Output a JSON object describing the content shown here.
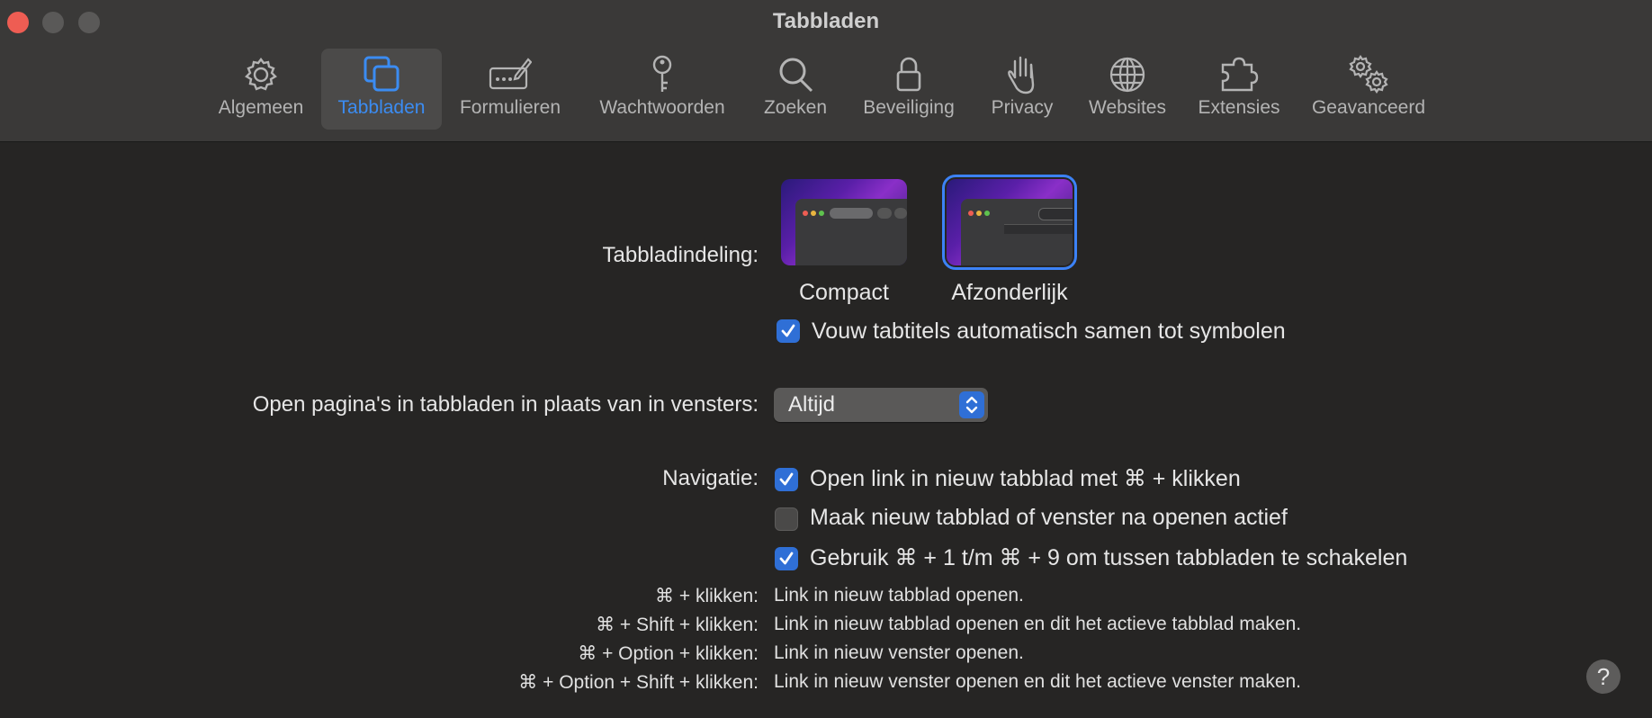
{
  "window": {
    "title": "Tabbladen"
  },
  "toolbar": {
    "tabs": [
      {
        "label": "Algemeen",
        "icon": "gear-icon"
      },
      {
        "label": "Tabbladen",
        "icon": "tabs-icon",
        "active": true
      },
      {
        "label": "Formulieren",
        "icon": "form-pen-icon"
      },
      {
        "label": "Wachtwoorden",
        "icon": "key-icon"
      },
      {
        "label": "Zoeken",
        "icon": "search-icon"
      },
      {
        "label": "Beveiliging",
        "icon": "lock-icon"
      },
      {
        "label": "Privacy",
        "icon": "hand-icon"
      },
      {
        "label": "Websites",
        "icon": "globe-icon"
      },
      {
        "label": "Extensies",
        "icon": "puzzle-icon"
      },
      {
        "label": "Geavanceerd",
        "icon": "gears-icon"
      }
    ]
  },
  "layout_setting": {
    "label": "Tabbladindeling:",
    "options": [
      {
        "label": "Compact",
        "selected": false
      },
      {
        "label": "Afzonderlijk",
        "selected": true
      }
    ],
    "collapse_checkbox": {
      "label": "Vouw tabtitels automatisch samen tot symbolen",
      "checked": true
    }
  },
  "open_pages": {
    "label": "Open pagina's in tabbladen in plaats van in vensters:",
    "value": "Altijd"
  },
  "navigation": {
    "label": "Navigatie:",
    "options": [
      {
        "label": "Open link in nieuw tabblad met ⌘ + klikken",
        "checked": true
      },
      {
        "label": "Maak nieuw tabblad of venster na openen actief",
        "checked": false
      },
      {
        "label": "Gebruik ⌘ + 1 t/m ⌘ + 9 om tussen tabbladen te schakelen",
        "checked": true
      }
    ]
  },
  "shortcuts": [
    {
      "keys": "⌘ + klikken:",
      "desc": "Link in nieuw tabblad openen."
    },
    {
      "keys": "⌘ + Shift + klikken:",
      "desc": "Link in nieuw tabblad openen en dit het actieve tabblad maken."
    },
    {
      "keys": "⌘ + Option + klikken:",
      "desc": "Link in nieuw venster openen."
    },
    {
      "keys": "⌘ + Option + Shift + klikken:",
      "desc": "Link in nieuw venster openen en dit het actieve venster maken."
    }
  ],
  "help": {
    "label": "?"
  },
  "colors": {
    "accent": "#2f6fd6",
    "active_tab_text": "#3b8cf2",
    "close": "#ee5d53"
  }
}
